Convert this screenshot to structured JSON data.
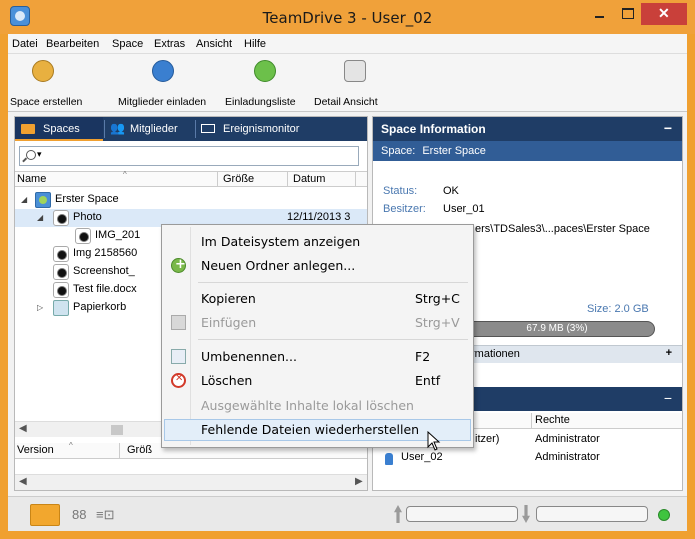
{
  "window": {
    "title": "TeamDrive 3 - User_02"
  },
  "menu": [
    "Datei",
    "Bearbeiten",
    "Space",
    "Extras",
    "Ansicht",
    "Hilfe"
  ],
  "toolbar": {
    "create_space": "Space erstellen",
    "invite_members": "Mitglieder einladen",
    "invitation_list": "Einladungsliste",
    "detail_view": "Detail Ansicht"
  },
  "left_tabs": {
    "spaces": "Spaces",
    "members": "Mitglieder",
    "event_monitor": "Ereignismonitor"
  },
  "search": {
    "placeholder": ""
  },
  "file_columns": {
    "name": "Name",
    "size": "Größe",
    "date": "Datum"
  },
  "tree": [
    {
      "label": "Erster Space",
      "icon": "space-icon"
    },
    {
      "label": "Photo",
      "icon": "camera-folder-icon",
      "extra": "12/11/2013 3"
    },
    {
      "label": "IMG_201",
      "icon": "camera-file-icon"
    },
    {
      "label": "Img 2158560",
      "icon": "camera-file-icon"
    },
    {
      "label": "Screenshot_",
      "icon": "camera-file-icon"
    },
    {
      "label": "Test file.docx",
      "icon": "camera-file-icon"
    },
    {
      "label": "Papierkorb",
      "icon": "trash-icon"
    }
  ],
  "version_columns": {
    "version": "Version",
    "size": "Größ"
  },
  "space_info": {
    "header": "Space Information",
    "space_label": "Space:",
    "space_name": "Erster Space",
    "status_key": "Status:",
    "status_value": "OK",
    "owner_key": "Besitzer:",
    "owner_value": "User_01",
    "path_tail": "ers\\TDSales3\\...paces\\Erster Space",
    "size_text": "Size: 2.0 GB",
    "usage_text": "67.9 MB (3%)",
    "usage_fraction": 0.03,
    "more_info": "rmationen"
  },
  "members_table": {
    "rights_header": "Rechte",
    "rows": [
      {
        "name_tail": "itzer)",
        "rights": "Administrator"
      },
      {
        "name": "User_02",
        "rights": "Administrator"
      }
    ]
  },
  "context_menu": {
    "items": [
      {
        "label": "Im Dateisystem anzeigen",
        "shortcut": "",
        "disabled": false,
        "icon": ""
      },
      {
        "label": "Neuen Ordner anlegen...",
        "shortcut": "",
        "disabled": false,
        "icon": "new-folder-icon"
      },
      {
        "label": "Kopieren",
        "shortcut": "Strg+C",
        "disabled": false,
        "icon": ""
      },
      {
        "label": "Einfügen",
        "shortcut": "Strg+V",
        "disabled": true,
        "icon": "paste-icon"
      },
      {
        "label": "Umbenennen...",
        "shortcut": "F2",
        "disabled": false,
        "icon": "rename-icon"
      },
      {
        "label": "Löschen",
        "shortcut": "Entf",
        "disabled": false,
        "icon": "delete-icon"
      },
      {
        "label": "Ausgewählte Inhalte lokal löschen",
        "shortcut": "",
        "disabled": true,
        "icon": ""
      },
      {
        "label": "Fehlende Dateien wiederherstellen",
        "shortcut": "",
        "disabled": false,
        "icon": ""
      }
    ]
  },
  "colors": {
    "title_bar": "#f0a13a",
    "panel_header": "#1f3d66",
    "accent_orange": "#f0a030",
    "close_button": "#c9403a",
    "status_online": "#3fc43f"
  }
}
